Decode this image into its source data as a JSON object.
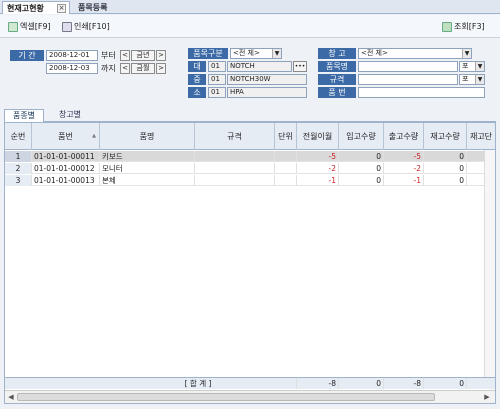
{
  "tabs": [
    {
      "label": "현재고현황"
    },
    {
      "label": "품목등록"
    }
  ],
  "tab_close": "×",
  "toolbar": {
    "excel_label": "엑셀[F9]",
    "print_label": "인쇄[F10]",
    "search_label": "조회[F3]"
  },
  "filters": {
    "period_label": "기   간",
    "date_from": "2008-12-01",
    "date_to": "2008-12-03",
    "from_suffix": "부터",
    "to_suffix": "까지",
    "prev_year": "<",
    "this_year": "금년",
    "next_year": ">",
    "prev_month": "<",
    "this_month": "금월",
    "next_month": ">",
    "item_type_label": "품목구분",
    "item_type_value": "<전 체>",
    "large_label": "대",
    "large_code": "01",
    "large_name": "NOTCH",
    "medium_label": "중",
    "medium_code": "01",
    "medium_name": "NOTCH30W",
    "small_label": "소",
    "small_code": "01",
    "small_name": "HPA",
    "more_btn": "•••",
    "warehouse_label": "창   고",
    "warehouse_value": "<전 체>",
    "item_name_label": "품목명",
    "item_name_value": "",
    "item_name_mode": "포",
    "spec_label": "규격",
    "spec_value": "",
    "spec_mode": "포",
    "item_no_label": "품   번",
    "item_no_value": ""
  },
  "subtabs": [
    {
      "label": "품종별"
    },
    {
      "label": "창고별"
    }
  ],
  "grid": {
    "headers": {
      "seq": "순번",
      "item_no": "품번",
      "item_name": "품명",
      "spec": "규격",
      "unit": "단위",
      "prev_carry": "전월이월",
      "in_qty": "입고수량",
      "out_qty": "출고수량",
      "stock_qty": "재고수량",
      "stock_price": "재고단"
    },
    "sort_icon": "▲",
    "rows": [
      {
        "seq": "1",
        "item_no": "01-01-01-00011",
        "item_name": "키보드",
        "spec": "",
        "unit": "",
        "prev_carry": "-5",
        "in_qty": "0",
        "out_qty": "-5",
        "stock_qty": "0"
      },
      {
        "seq": "2",
        "item_no": "01-01-01-00012",
        "item_name": "모니터",
        "spec": "",
        "unit": "",
        "prev_carry": "-2",
        "in_qty": "0",
        "out_qty": "-2",
        "stock_qty": "0"
      },
      {
        "seq": "3",
        "item_no": "01-01-01-00013",
        "item_name": "본체",
        "spec": "",
        "unit": "",
        "prev_carry": "-1",
        "in_qty": "0",
        "out_qty": "-1",
        "stock_qty": "0"
      }
    ],
    "totals": {
      "label": "[ 합         계 ]",
      "prev_carry": "-8",
      "in_qty": "0",
      "out_qty": "-8",
      "stock_qty": "0"
    }
  },
  "scroll_left": "◀",
  "scroll_right": "▶"
}
